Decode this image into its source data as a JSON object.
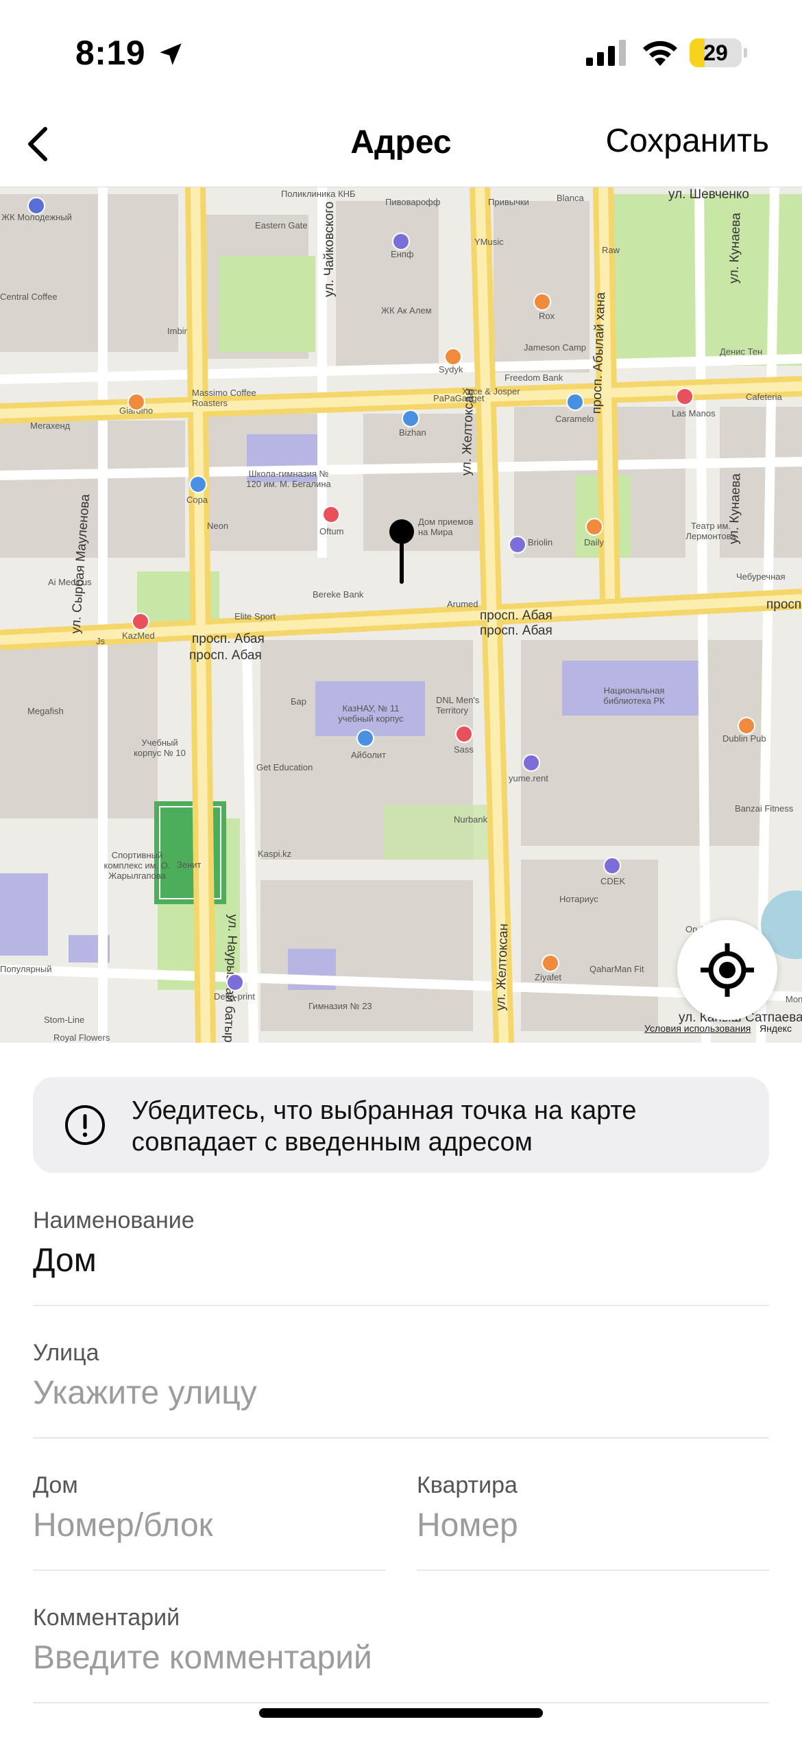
{
  "status_bar": {
    "time": "8:19",
    "battery_level": "29",
    "battery_fraction": 0.29,
    "icons": [
      "location-arrow-icon",
      "signal-icon",
      "wifi-icon",
      "battery-icon"
    ]
  },
  "nav": {
    "title": "Адрес",
    "save_label": "Сохранить",
    "back_icon": "chevron-left-icon"
  },
  "map": {
    "streets": [
      "ул. Шевченко",
      "ул. Чайковского",
      "ул. Желтоксан",
      "просп. Абылай хана",
      "ул. Кунаева",
      "ул. Кунаева",
      "ул. Сырбая Мауленова",
      "просп. Абая",
      "просп. Абая",
      "просп. Абая",
      "просп. Абая",
      "ул. Желтоксан",
      "ул. Наурызбай батыра",
      "ул. Каныш Сатпаева",
      "просп. Абая"
    ],
    "labels": [
      "Поликлиника КНБ",
      "Пивоварофф",
      "Привычки",
      "Blanca",
      "ЖК Молодежный",
      "Eastern Gate",
      "Енпф",
      "YMusic",
      "Central Coffee",
      "ЖК Ак Алем",
      "Sydyk",
      "Rox",
      "Jameson Camp",
      "Raw",
      "Денис Тен",
      "Imbir",
      "Massimo Coffee Roasters",
      "Giardino",
      "Xoce & Josper",
      "Freedom Bank",
      "Cafeteria",
      "Мегахенд",
      "Bizhan",
      "PaPaGadget",
      "Caramelo",
      "Las Manos",
      "Школа-гимназия № 120 им. М. Бегалина",
      "Copa",
      "Дом приемов на Мира",
      "Briolin",
      "Daily",
      "Театр им. Лермонтова",
      "Neon",
      "Oftum",
      "Ai Medicus",
      "Bereke Bank",
      "Arumed",
      "Чебуречная",
      "Elite Sport",
      "KazMed",
      "Js",
      "Бар",
      "DNL Men's Territory",
      "Национальная библиотека РК",
      "Megafish",
      "КазНАУ, № 11 учебный корпус",
      "Айболит",
      "Sass",
      "Dublin Pub",
      "Учебный корпус № 10",
      "Get Education",
      "yume.rent",
      "Banzai Fitness",
      "Спортивный комплекс им. О. Жарылгапова",
      "Зенит",
      "Kaspi.kz",
      "Nurbank",
      "CDEK",
      "Нотариус",
      "On Clinic",
      "Популярный",
      "Delta-print",
      "Ziyafet",
      "QaharMan Fit",
      "Гимназия № 23",
      "Stom-Line",
      "Royal Flowers",
      "Mons"
    ],
    "terms_text": "Условия использования",
    "brand_text": "Яндекс",
    "locate_icon": "crosshair-locate-icon"
  },
  "info": {
    "icon": "exclamation-circle-icon",
    "text": "Убедитесь, что выбранная точка на карте совпадает с введенным адресом"
  },
  "form": {
    "name_label": "Наименование",
    "name_value": "Дом",
    "street_label": "Улица",
    "street_placeholder": "Укажите улицу",
    "house_label": "Дом",
    "house_placeholder": "Номер/блок",
    "apt_label": "Квартира",
    "apt_placeholder": "Номер",
    "comment_label": "Комментарий",
    "comment_placeholder": "Введите комментарий"
  },
  "colors": {
    "battery_fill": "#f7d21e",
    "road_major": "#f9e27a",
    "park": "#c8e6a5",
    "building": "#d7d3cc",
    "banner_bg": "#efeff1"
  }
}
